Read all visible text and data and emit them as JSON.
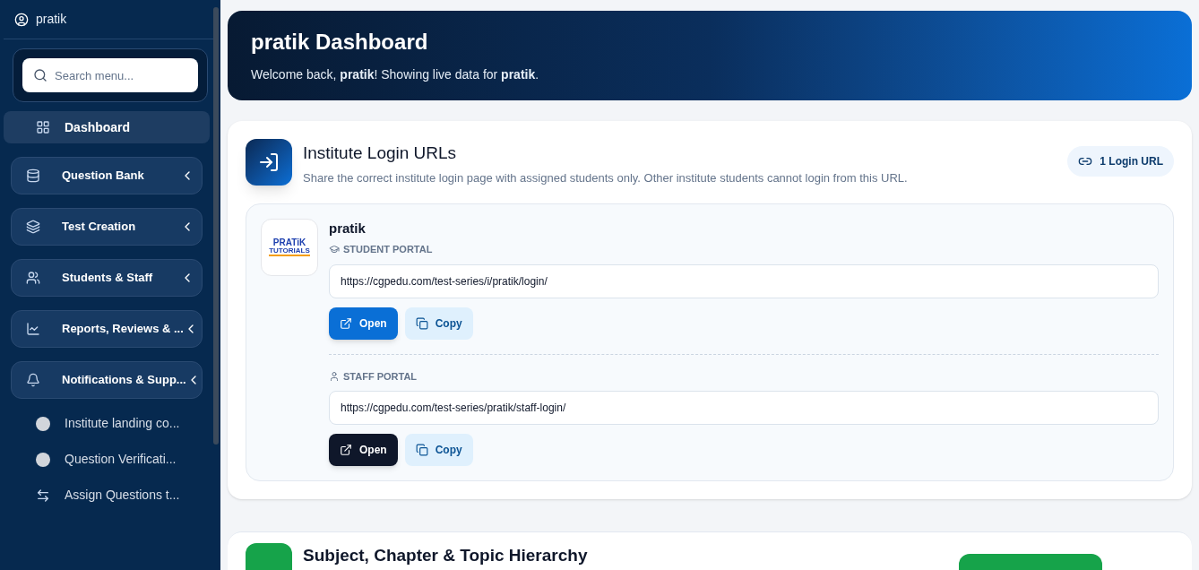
{
  "sidebar": {
    "user": "pratik",
    "search": {
      "placeholder": "Search menu..."
    },
    "items": [
      {
        "kind": "link",
        "label": "Dashboard",
        "selected": true
      },
      {
        "kind": "group",
        "label": "Question Bank",
        "selected": false
      },
      {
        "kind": "group",
        "label": "Test Creation",
        "selected": false
      },
      {
        "kind": "group",
        "label": "Students & Staff",
        "selected": false
      },
      {
        "kind": "group",
        "label": "Reports, Reviews & ...",
        "selected": false
      },
      {
        "kind": "group",
        "label": "Notifications & Supp...",
        "selected": false
      },
      {
        "kind": "sub",
        "label": "Institute landing co...",
        "selected": false
      },
      {
        "kind": "sub",
        "label": "Question Verificati...",
        "selected": false
      },
      {
        "kind": "sub",
        "label": "Assign Questions t...",
        "selected": false
      }
    ]
  },
  "hero": {
    "title": "pratik Dashboard",
    "subtitle": "Welcome back, **pratik**! Showing live data for **pratik**."
  },
  "login_card": {
    "title": "Institute Login URLs",
    "description": "Share the correct institute login page with assigned students only. Other institute students cannot login from this URL.",
    "badge": "1 Login URL",
    "institute": {
      "name": "pratik",
      "logo_lines": [
        "PRATiK",
        "TUTORIALS"
      ],
      "portals": [
        {
          "kind": "student",
          "label": "STUDENT PORTAL",
          "url": "https://cgpedu.com/test-series/i/pratik/login/",
          "open": "Open",
          "copy": "Copy",
          "color": "#0a6fd6"
        },
        {
          "kind": "staff",
          "label": "STAFF PORTAL",
          "url": "https://cgpedu.com/test-series/pratik/staff-login/",
          "open": "Open",
          "copy": "Copy",
          "color": "#0f172a"
        }
      ]
    }
  },
  "next_card": {
    "title": "Subject, Chapter & Topic Hierarchy"
  }
}
